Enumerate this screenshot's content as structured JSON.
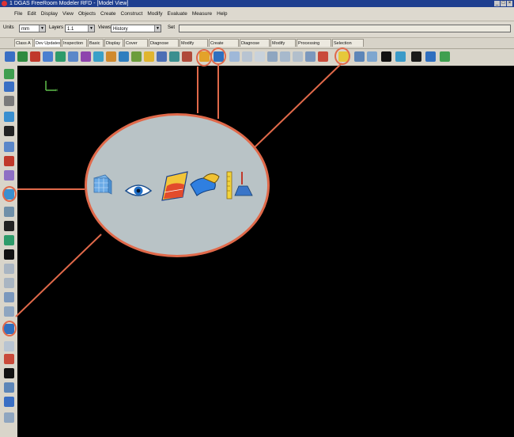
{
  "window": {
    "title": "1 DGAS FreeRoom Modeler RFD - [Model View]"
  },
  "menu": [
    "File",
    "Edit",
    "Display",
    "View",
    "Objects",
    "Create",
    "Construct",
    "Modify",
    "Evaluate",
    "Measure",
    "Help"
  ],
  "selection": {
    "units_label": "Units",
    "units_value": "mm",
    "layers_label": "Layers",
    "layers_value": "1.1",
    "views_label": "Views",
    "views_value": "History",
    "set_label": "Set"
  },
  "tabs": [
    "Class A",
    "Dev Updates",
    "Inspection",
    "Basic",
    "Display",
    "Cover",
    "Diagnose",
    "Modify",
    "Create",
    "Diagnose",
    "Modify",
    "Processing",
    "Selection"
  ],
  "selected_tab": "Dev Updates",
  "zoom_icons": [
    "wireframe-cube-icon",
    "eye-icon",
    "surface-analysis-icon",
    "surface-blend-icon",
    "ruler-probe-icon"
  ],
  "colors": {
    "highlight": "#e0694a",
    "titlebar": "#1f3f8f",
    "toolbar_bg": "#d9d5ca",
    "canvas": "#000000",
    "zoom_bg": "#b9c3c6"
  }
}
